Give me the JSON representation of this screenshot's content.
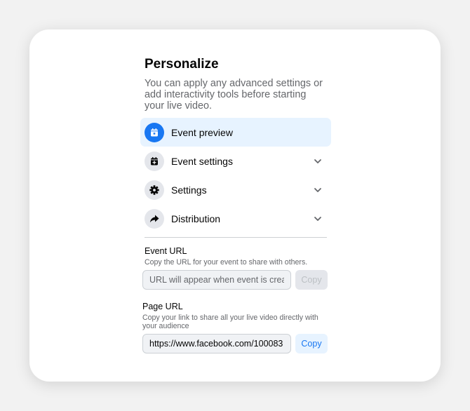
{
  "header": {
    "title": "Personalize",
    "subtitle": "You can apply any advanced settings or add interactivity tools before starting your live video."
  },
  "menu": {
    "items": [
      {
        "label": "Event preview",
        "icon": "calendar-star-icon",
        "active": true,
        "has_chevron": false
      },
      {
        "label": "Event settings",
        "icon": "calendar-plus-icon",
        "active": false,
        "has_chevron": true
      },
      {
        "label": "Settings",
        "icon": "gear-icon",
        "active": false,
        "has_chevron": true
      },
      {
        "label": "Distribution",
        "icon": "share-arrow-icon",
        "active": false,
        "has_chevron": true
      }
    ]
  },
  "event_url": {
    "title": "Event URL",
    "description": "Copy the URL for your event to share with others.",
    "placeholder": "URL will appear when event is created",
    "value": "",
    "copy_label": "Copy",
    "copy_enabled": false
  },
  "page_url": {
    "title": "Page URL",
    "description": "Copy your link to share all your live video directly with your audience",
    "value": "https://www.facebook.com/100083",
    "copy_label": "Copy",
    "copy_enabled": true
  },
  "colors": {
    "accent": "#1877f2",
    "active_bg": "#e7f3ff",
    "icon_bg": "#e4e6eb",
    "secondary_text": "#65676b"
  }
}
